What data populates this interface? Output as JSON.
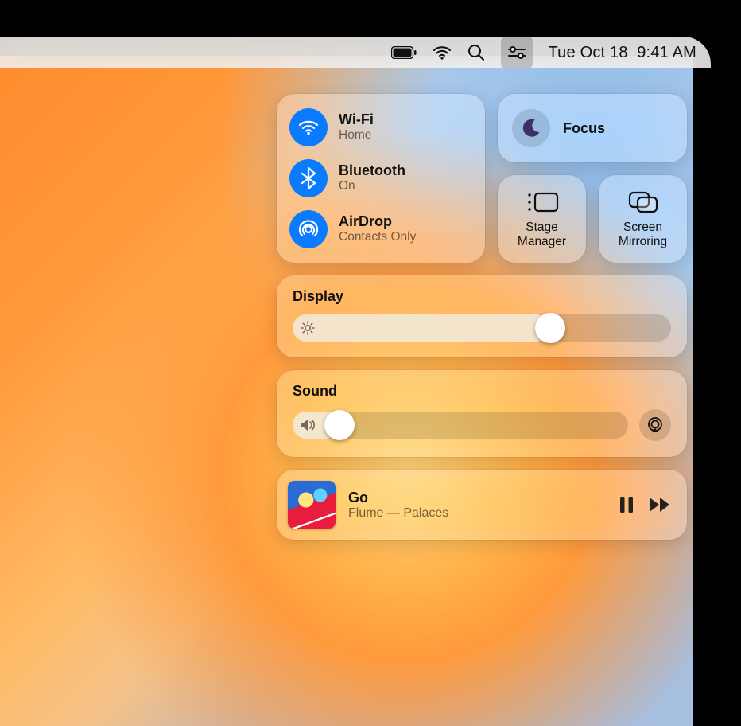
{
  "menubar": {
    "date": "Tue Oct 18",
    "time": "9:41 AM"
  },
  "connectivity": {
    "wifi": {
      "title": "Wi-Fi",
      "sub": "Home"
    },
    "bluetooth": {
      "title": "Bluetooth",
      "sub": "On"
    },
    "airdrop": {
      "title": "AirDrop",
      "sub": "Contacts Only"
    }
  },
  "focus": {
    "label": "Focus"
  },
  "tiles": {
    "stage": {
      "label": "Stage\nManager"
    },
    "mirror": {
      "label": "Screen\nMirroring"
    }
  },
  "display": {
    "title": "Display",
    "value_pct": 68
  },
  "sound": {
    "title": "Sound",
    "value_pct": 14
  },
  "nowplaying": {
    "title": "Go",
    "subtitle": "Flume — Palaces"
  }
}
